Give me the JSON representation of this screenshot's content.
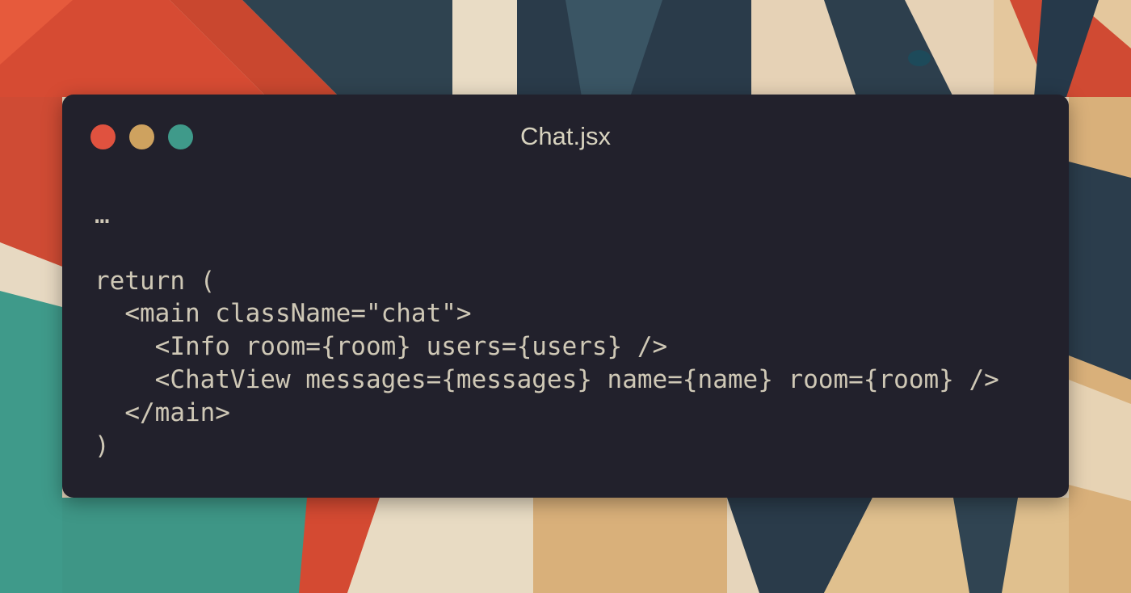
{
  "window": {
    "title": "Chat.jsx"
  },
  "colors": {
    "close": "#e0523f",
    "minimize": "#cea25f",
    "maximize": "#3f9a8a",
    "window_bg": "#22212c"
  },
  "code": {
    "lines": [
      "…",
      "",
      "return (",
      "  <main className=\"chat\">",
      "    <Info room={room} users={users} />",
      "    <ChatView messages={messages} name={name} room={room} />",
      "  </main>",
      ")"
    ]
  }
}
